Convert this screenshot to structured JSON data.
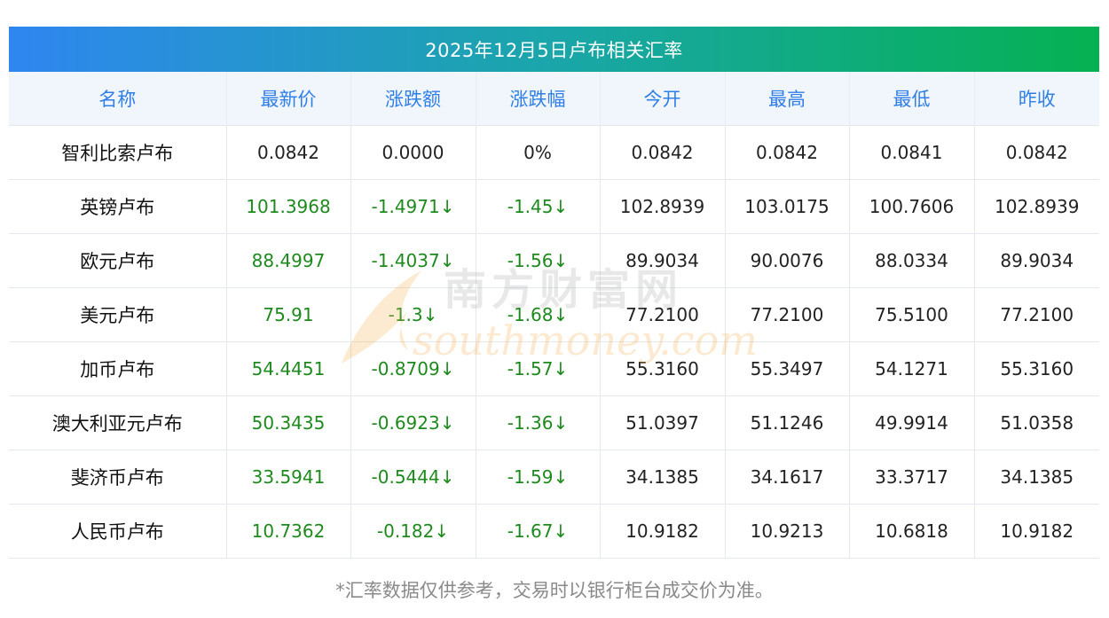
{
  "title": "2025年12月5日卢布相关汇率",
  "headers": [
    "名称",
    "最新价",
    "涨跌额",
    "涨跌幅",
    "今开",
    "最高",
    "最低",
    "昨收"
  ],
  "rows": [
    {
      "name": "智利比索卢布",
      "latest": "0.0842",
      "change": "0.0000",
      "pct": "0%",
      "open": "0.0842",
      "high": "0.0842",
      "low": "0.0841",
      "prev": "0.0842",
      "down": false
    },
    {
      "name": "英镑卢布",
      "latest": "101.3968",
      "change": "-1.4971↓",
      "pct": "-1.45↓",
      "open": "102.8939",
      "high": "103.0175",
      "low": "100.7606",
      "prev": "102.8939",
      "down": true
    },
    {
      "name": "欧元卢布",
      "latest": "88.4997",
      "change": "-1.4037↓",
      "pct": "-1.56↓",
      "open": "89.9034",
      "high": "90.0076",
      "low": "88.0334",
      "prev": "89.9034",
      "down": true
    },
    {
      "name": "美元卢布",
      "latest": "75.91",
      "change": "-1.3↓",
      "pct": "-1.68↓",
      "open": "77.2100",
      "high": "77.2100",
      "low": "75.5100",
      "prev": "77.2100",
      "down": true
    },
    {
      "name": "加币卢布",
      "latest": "54.4451",
      "change": "-0.8709↓",
      "pct": "-1.57↓",
      "open": "55.3160",
      "high": "55.3497",
      "low": "54.1271",
      "prev": "55.3160",
      "down": true
    },
    {
      "name": "澳大利亚元卢布",
      "latest": "50.3435",
      "change": "-0.6923↓",
      "pct": "-1.36↓",
      "open": "51.0397",
      "high": "51.1246",
      "low": "49.9914",
      "prev": "51.0358",
      "down": true
    },
    {
      "name": "斐济币卢布",
      "latest": "33.5941",
      "change": "-0.5444↓",
      "pct": "-1.59↓",
      "open": "34.1385",
      "high": "34.1617",
      "low": "33.3717",
      "prev": "34.1385",
      "down": true
    },
    {
      "name": "人民币卢布",
      "latest": "10.7362",
      "change": "-0.182↓",
      "pct": "-1.67↓",
      "open": "10.9182",
      "high": "10.9213",
      "low": "10.6818",
      "prev": "10.9182",
      "down": true
    }
  ],
  "note": "*汇率数据仅供参考，交易时以银行柜台成交价为准。",
  "watermark": {
    "cn": "南方财富网",
    "en": "southmoney.com"
  },
  "colors": {
    "header_text": "#2f7fe6",
    "down": "#1e8a1e",
    "gradient_start": "#2f86f0",
    "gradient_end": "#05b152"
  }
}
